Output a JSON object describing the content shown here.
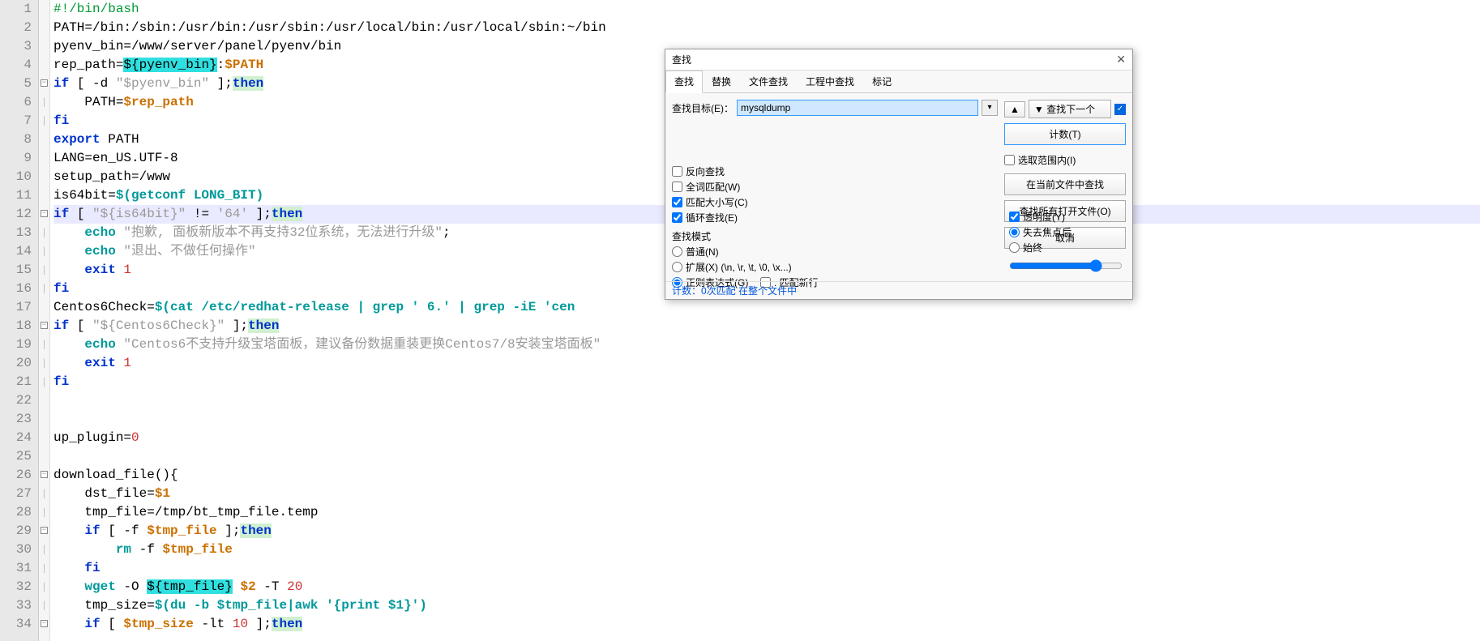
{
  "lines": [
    {
      "n": 1,
      "fold": "",
      "html": "<span class='c-comment'>#!/bin/bash</span>"
    },
    {
      "n": 2,
      "fold": "",
      "html": "<span class='c-black'>PATH=/bin:/sbin:/usr/bin:/usr/sbin:/usr/local/bin:/usr/local/sbin:~/bin</span>"
    },
    {
      "n": 3,
      "fold": "",
      "html": "<span class='c-black'>pyenv_bin=/www/server/panel/pyenv/bin</span>"
    },
    {
      "n": 4,
      "fold": "",
      "html": "<span class='c-black'>rep_path=</span><span class='c-var-hl'>${pyenv_bin}</span><span class='c-black'>:</span><span class='c-var'>$PATH</span>"
    },
    {
      "n": 5,
      "fold": "box",
      "html": "<span class='c-keyword'>if</span> <span class='c-black'>[ </span><span class='c-black'>-d</span> <span class='c-string'>\"$pyenv_bin\"</span> <span class='c-black'>];</span><span class='c-keyword-hl'>then</span>"
    },
    {
      "n": 6,
      "fold": "line",
      "html": "    <span class='c-black'>PATH=</span><span class='c-var'>$rep_path</span>"
    },
    {
      "n": 7,
      "fold": "line",
      "html": "<span class='c-keyword'>fi</span>"
    },
    {
      "n": 8,
      "fold": "",
      "html": "<span class='c-keyword'>export</span> <span class='c-black'>PATH</span>"
    },
    {
      "n": 9,
      "fold": "",
      "html": "<span class='c-black'>LANG=en_US.UTF-8</span>"
    },
    {
      "n": 10,
      "fold": "",
      "html": "<span class='c-black'>setup_path=/www</span>"
    },
    {
      "n": 11,
      "fold": "",
      "html": "<span class='c-black'>is64bit=</span><span class='c-cmd'>$(getconf LONG_BIT)</span>"
    },
    {
      "n": 12,
      "fold": "box",
      "html": "<span class='c-keyword'>if</span> <span class='c-black'>[ </span><span class='c-string'>\"${is64bit}\"</span> <span class='c-black'>!= </span><span class='c-string'>'64'</span> <span class='c-black'>];</span><span class='c-keyword-hl'>then</span>",
      "current": true
    },
    {
      "n": 13,
      "fold": "line",
      "html": "    <span class='c-cmd'>echo</span> <span class='c-string'>\"抱歉, 面板新版本不再支持32位系统，无法进行升级\"</span><span class='c-black'>;</span>"
    },
    {
      "n": 14,
      "fold": "line",
      "html": "    <span class='c-cmd'>echo</span> <span class='c-string'>\"退出、不做任何操作\"</span>"
    },
    {
      "n": 15,
      "fold": "line",
      "html": "    <span class='c-keyword'>exit</span> <span class='c-num'>1</span>"
    },
    {
      "n": 16,
      "fold": "line",
      "html": "<span class='c-keyword'>fi</span>"
    },
    {
      "n": 17,
      "fold": "",
      "html": "<span class='c-black'>Centos6Check=</span><span class='c-cmd'>$(cat /etc/redhat-release | grep ' 6.' | grep -iE 'cen</span>"
    },
    {
      "n": 18,
      "fold": "box",
      "html": "<span class='c-keyword'>if</span> <span class='c-black'>[ </span><span class='c-string'>\"${Centos6Check}\"</span> <span class='c-black'>];</span><span class='c-keyword-hl'>then</span>"
    },
    {
      "n": 19,
      "fold": "line",
      "html": "    <span class='c-cmd'>echo</span> <span class='c-string'>\"Centos6不支持升级宝塔面板，建议备份数据重装更换Centos7/8安装宝塔面板\"</span>"
    },
    {
      "n": 20,
      "fold": "line",
      "html": "    <span class='c-keyword'>exit</span> <span class='c-num'>1</span>"
    },
    {
      "n": 21,
      "fold": "line",
      "html": "<span class='c-keyword'>fi</span>"
    },
    {
      "n": 22,
      "fold": "",
      "html": ""
    },
    {
      "n": 23,
      "fold": "",
      "html": ""
    },
    {
      "n": 24,
      "fold": "",
      "html": "<span class='c-black'>up_plugin=</span><span class='c-num'>0</span>"
    },
    {
      "n": 25,
      "fold": "",
      "html": ""
    },
    {
      "n": 26,
      "fold": "box",
      "html": "<span class='c-black'>download_file(){</span>"
    },
    {
      "n": 27,
      "fold": "line",
      "html": "    <span class='c-black'>dst_file=</span><span class='c-var'>$1</span>"
    },
    {
      "n": 28,
      "fold": "line",
      "html": "    <span class='c-black'>tmp_file=/tmp/bt_tmp_file.temp</span>"
    },
    {
      "n": 29,
      "fold": "box",
      "html": "    <span class='c-keyword'>if</span> <span class='c-black'>[ -f </span><span class='c-var'>$tmp_file</span> <span class='c-black'>];</span><span class='c-keyword-hl'>then</span>"
    },
    {
      "n": 30,
      "fold": "line",
      "html": "        <span class='c-cmd'>rm</span> <span class='c-black'>-f </span><span class='c-var'>$tmp_file</span>"
    },
    {
      "n": 31,
      "fold": "line",
      "html": "    <span class='c-keyword'>fi</span>"
    },
    {
      "n": 32,
      "fold": "line",
      "html": "    <span class='c-cmd'>wget</span> <span class='c-black'>-O </span><span class='c-var-hl'>${tmp_file}</span> <span class='c-var'>$2</span> <span class='c-black'>-T </span><span class='c-num'>20</span>"
    },
    {
      "n": 33,
      "fold": "line",
      "html": "    <span class='c-black'>tmp_size=</span><span class='c-cmd'>$(du -b $tmp_file|awk '{print $1}')</span>"
    },
    {
      "n": 34,
      "fold": "box",
      "html": "    <span class='c-keyword'>if</span> <span class='c-black'>[ </span><span class='c-var'>$tmp_size</span> <span class='c-black'>-lt </span><span class='c-num'>10</span> <span class='c-black'>];</span><span class='c-keyword-hl'>then</span>"
    }
  ],
  "find": {
    "title": "查找",
    "tabs": [
      "查找",
      "替换",
      "文件查找",
      "工程中查找",
      "标记"
    ],
    "active_tab": 0,
    "target_label": "查找目标(E)：",
    "target_value": "mysqldump",
    "nav_up": "▲",
    "nav_next": "▼ 查找下一个",
    "buttons": {
      "count": "计数(T)",
      "in_current": "在当前文件中查找",
      "all_open": "查找所有打开文件(O)",
      "cancel": "取消"
    },
    "scope_checkbox": "选取范围内(I)",
    "checks": {
      "reverse": "反向查找",
      "whole_word": "全词匹配(W)",
      "match_case": "匹配大小写(C)",
      "wrap": "循环查找(E)"
    },
    "mode_label": "查找模式",
    "modes": {
      "normal": "普通(N)",
      "extended": "扩展(X) (\\n, \\r, \\t, \\0, \\x...)",
      "regex": "正则表达式(G)",
      "match_newline": ". 匹配新行"
    },
    "transparency": {
      "label": "透明度(Y)",
      "on_lose": "失去焦点后",
      "always": "始终"
    },
    "status": "计数：0次匹配 在整个文件中"
  }
}
